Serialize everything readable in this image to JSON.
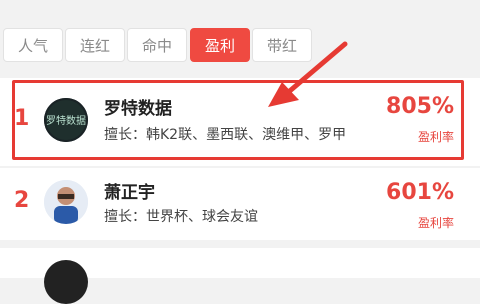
{
  "tabs": [
    {
      "label": "人气"
    },
    {
      "label": "连红"
    },
    {
      "label": "命中"
    },
    {
      "label": "盈利",
      "active": true
    },
    {
      "label": "带红"
    }
  ],
  "list": [
    {
      "rank": "1",
      "name": "罗特数据",
      "logo_text": "罗特数据",
      "specialty": "擅长：韩K2联、墨西联、澳维甲、罗甲",
      "rate": "805%",
      "rate_label": "盈利率"
    },
    {
      "rank": "2",
      "name": "萧正宇",
      "specialty": "擅长：世界杯、球会友谊",
      "rate": "601%",
      "rate_label": "盈利率"
    },
    {
      "rank": "",
      "name": "",
      "specialty": "",
      "rate": "",
      "rate_label": ""
    }
  ],
  "colors": {
    "accent": "#ef4a41",
    "highlight_box": "#e63a33",
    "arrow": "#e63a33"
  },
  "icons": {
    "arrow": "red-annotation-arrow-icon"
  }
}
